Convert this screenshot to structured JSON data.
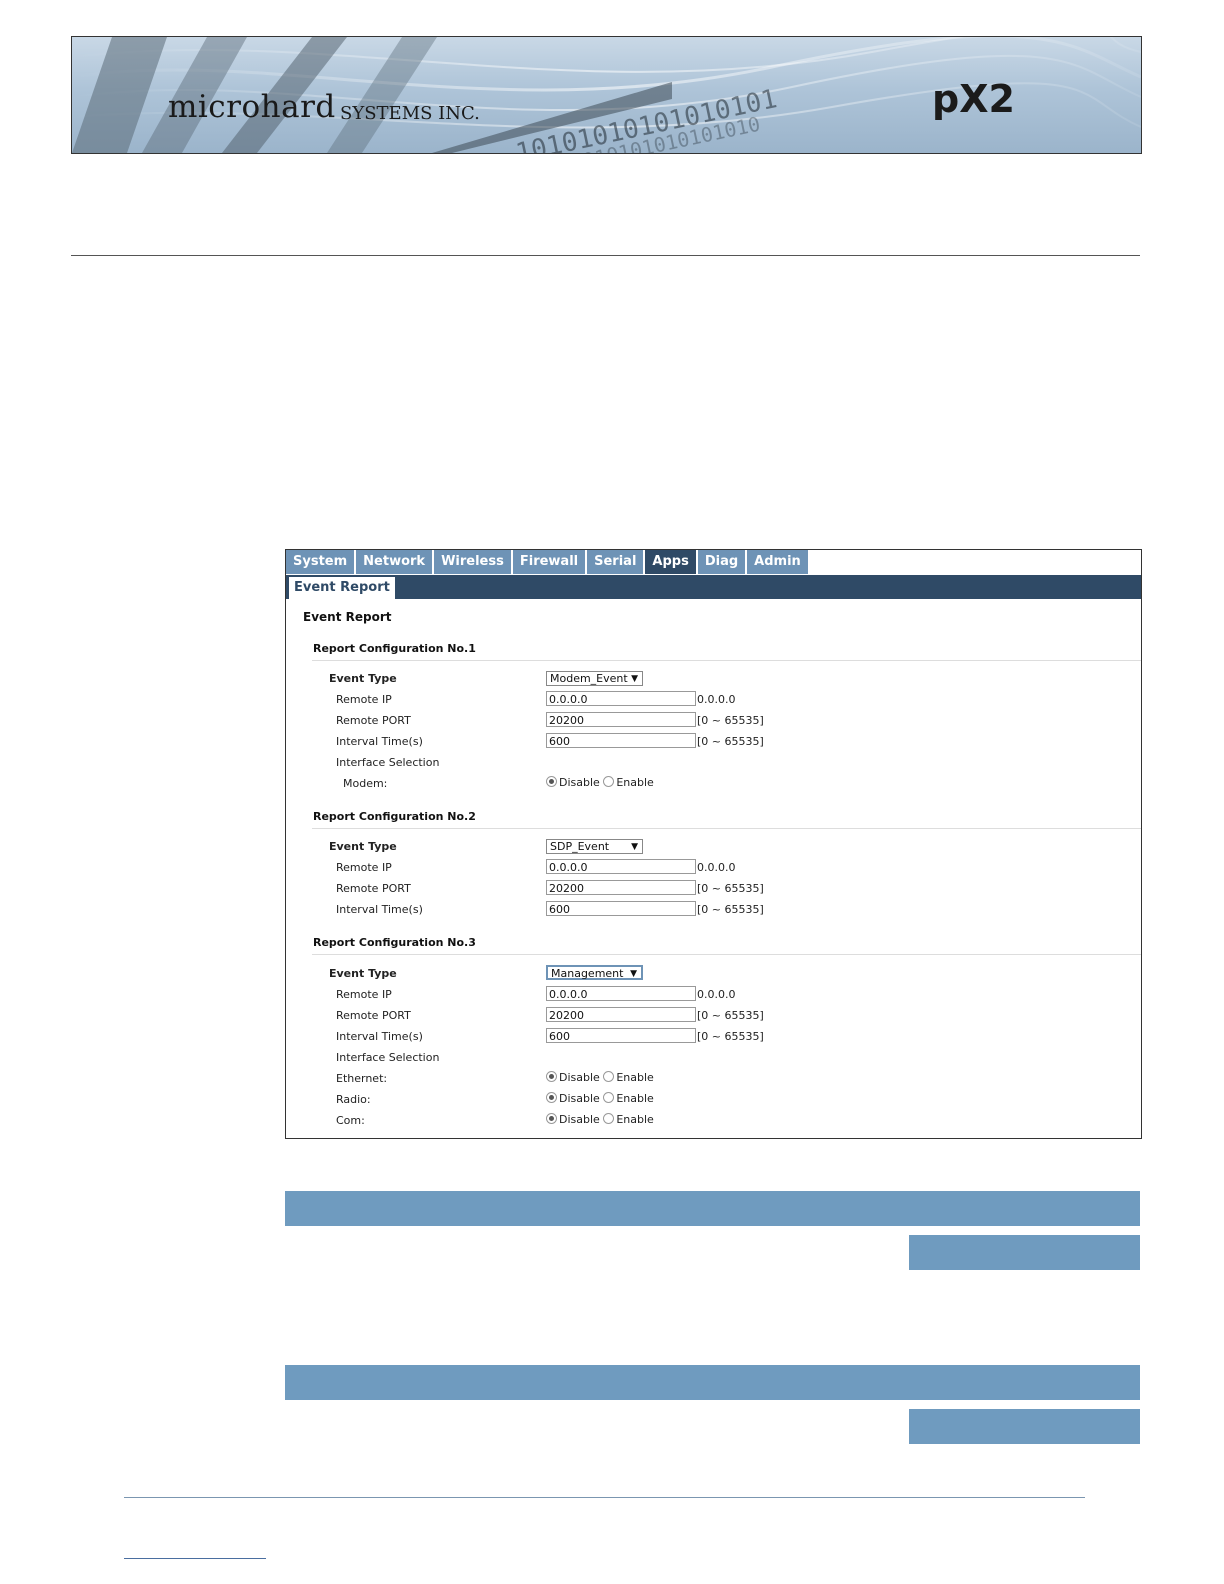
{
  "header": {
    "brand": "microhard",
    "brand_suffix": "SYSTEMS INC.",
    "model": "pX2"
  },
  "ui": {
    "tabs": [
      "System",
      "Network",
      "Wireless",
      "Firewall",
      "Serial",
      "Apps",
      "Diag",
      "Admin"
    ],
    "active_tab": "Apps",
    "subtab": "Event Report",
    "page_title": "Event Report",
    "configs": [
      {
        "title": "Report Configuration No.1",
        "event_type_label": "Event Type",
        "event_type": "Modem_Event",
        "remote_ip_label": "Remote IP",
        "remote_ip": "0.0.0.0",
        "remote_ip_hint": "0.0.0.0",
        "remote_port_label": "Remote PORT",
        "remote_port": "20200",
        "remote_port_hint": "[0 ~ 65535]",
        "interval_label": "Interval Time(s)",
        "interval": "600",
        "interval_hint": "[0 ~ 65535]",
        "interface_label": "Interface Selection",
        "interfaces": [
          {
            "label": "Modem:",
            "disable": "Disable",
            "enable": "Enable",
            "selected": "Disable"
          }
        ]
      },
      {
        "title": "Report Configuration No.2",
        "event_type_label": "Event Type",
        "event_type": "SDP_Event",
        "remote_ip_label": "Remote IP",
        "remote_ip": "0.0.0.0",
        "remote_ip_hint": "0.0.0.0",
        "remote_port_label": "Remote PORT",
        "remote_port": "20200",
        "remote_port_hint": "[0 ~ 65535]",
        "interval_label": "Interval Time(s)",
        "interval": "600",
        "interval_hint": "[0 ~ 65535]"
      },
      {
        "title": "Report Configuration No.3",
        "event_type_label": "Event Type",
        "event_type": "Management",
        "remote_ip_label": "Remote IP",
        "remote_ip": "0.0.0.0",
        "remote_ip_hint": "0.0.0.0",
        "remote_port_label": "Remote PORT",
        "remote_port": "20200",
        "remote_port_hint": "[0 ~ 65535]",
        "interval_label": "Interval Time(s)",
        "interval": "600",
        "interval_hint": "[0 ~ 65535]",
        "interface_label": "Interface Selection",
        "interfaces": [
          {
            "label": "Ethernet:",
            "disable": "Disable",
            "enable": "Enable",
            "selected": "Disable"
          },
          {
            "label": "Radio:",
            "disable": "Disable",
            "enable": "Enable",
            "selected": "Disable"
          },
          {
            "label": "Com:",
            "disable": "Disable",
            "enable": "Enable",
            "selected": "Disable"
          }
        ]
      }
    ]
  },
  "colors": {
    "tab": "#6e93b6",
    "tab_active": "#2f4a66",
    "page_bar": "#6f9bbf"
  }
}
